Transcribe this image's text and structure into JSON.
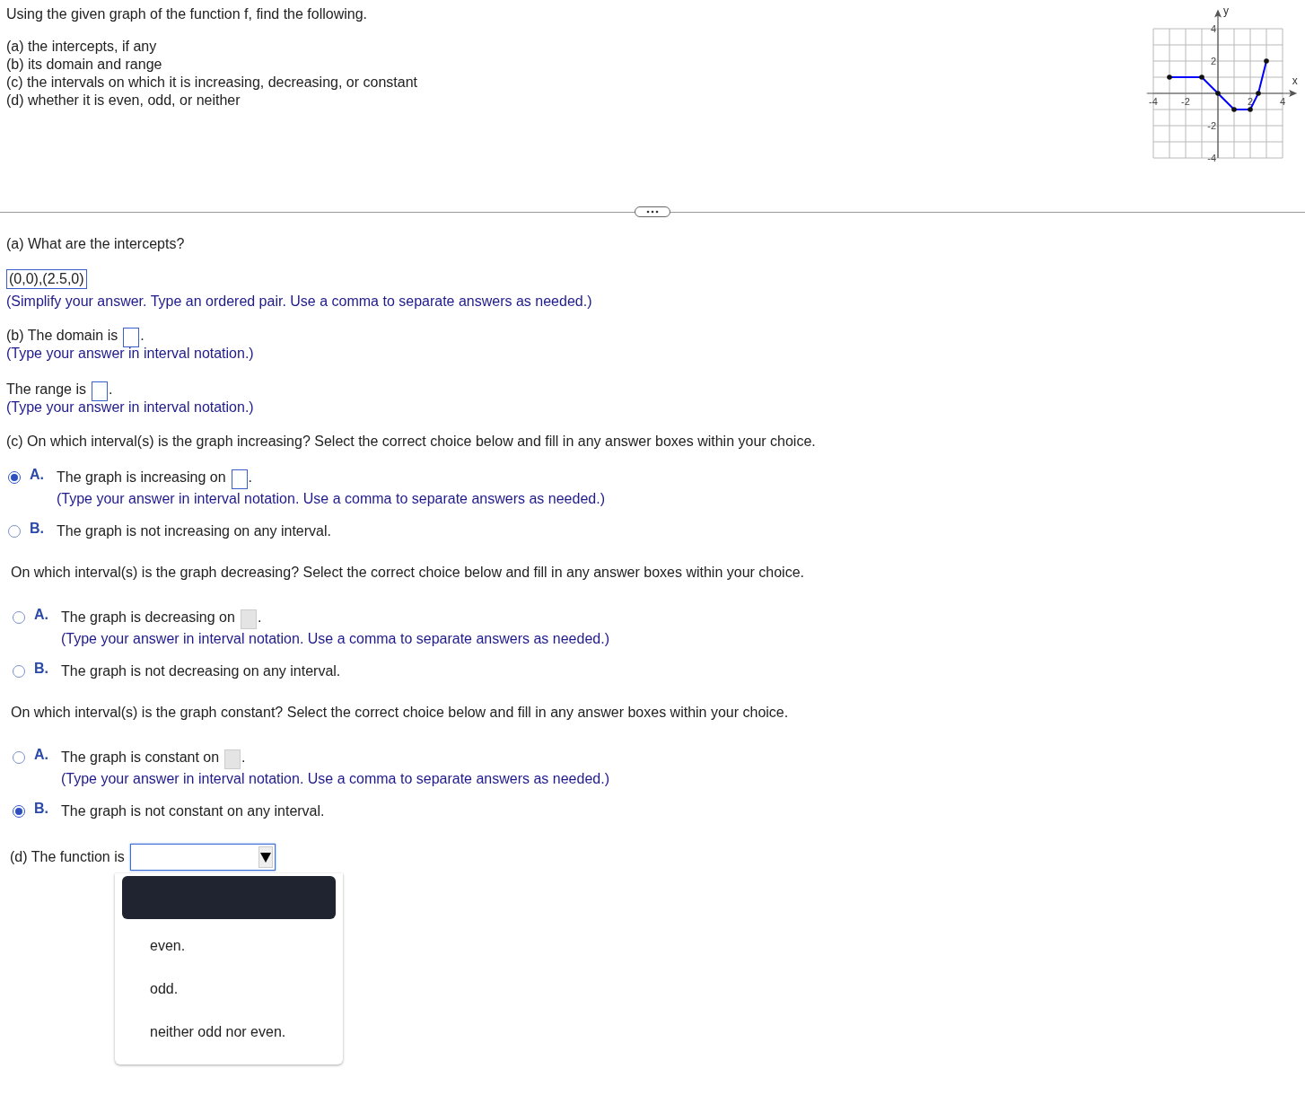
{
  "problem": {
    "intro": "Using the given graph of the function f, find the following.",
    "parts": [
      "(a)  the intercepts, if any",
      "(b)  its domain and range",
      "(c)  the intervals on which it is increasing, decreasing, or constant",
      "(d)  whether it is even, odd, or neither"
    ],
    "chart_data": {
      "type": "line",
      "grid": true,
      "xlabel": "x",
      "ylabel": "y",
      "xlim": [
        -4,
        4
      ],
      "ylim": [
        -4,
        4
      ],
      "xticks": [
        -4,
        -2,
        2,
        4
      ],
      "yticks": [
        -4,
        -2,
        2,
        4
      ],
      "x": [
        -3,
        -1,
        0,
        1,
        2,
        2.5,
        3
      ],
      "series": [
        {
          "color": "#0000ff",
          "values": [
            1,
            1,
            0,
            -1,
            -1,
            0,
            2
          ]
        }
      ]
    }
  },
  "part_a": {
    "question": "(a)  What are the intercepts?",
    "answer": "(0,0),(2.5,0)",
    "hint": "(Simplify your answer. Type an ordered pair. Use a comma to separate answers as needed.)"
  },
  "part_b": [
    {
      "label": "(b)  The domain is",
      "end": ".",
      "hint": "(Type your answer in interval notation.)"
    },
    {
      "label": "The range is",
      "end": ".",
      "hint": "(Type your answer in interval notation.)"
    }
  ],
  "part_c": [
    {
      "question": "(c)  On which interval(s) is the graph increasing?  Select the correct choice below and fill in any answer boxes within your choice.",
      "choices": [
        {
          "letter": "A.",
          "text": "The graph is increasing on",
          "end": ".",
          "field_disabled": false,
          "hint": "(Type your answer in interval notation. Use a comma to separate answers as needed.)",
          "selected": true
        },
        {
          "letter": "B.",
          "text": "The graph is not increasing on any interval.",
          "selected": false
        }
      ]
    },
    {
      "question": "On which interval(s) is the graph decreasing? Select the correct choice below and fill in any answer boxes within your choice.",
      "choices": [
        {
          "letter": "A.",
          "text": "The graph is decreasing on",
          "end": ".",
          "field_disabled": true,
          "hint": "(Type your answer in interval notation. Use a comma to separate answers as needed.)",
          "selected": false
        },
        {
          "letter": "B.",
          "text": "The graph is not decreasing on any interval.",
          "selected": false
        }
      ]
    },
    {
      "question": "On which interval(s) is the graph constant? Select the correct choice below and fill in any answer boxes within your choice.",
      "choices": [
        {
          "letter": "A.",
          "text": "The graph is constant on",
          "end": ".",
          "field_disabled": true,
          "hint": "(Type your answer in interval notation. Use a comma to separate answers as needed.)",
          "selected": false
        },
        {
          "letter": "B.",
          "text": "The graph is not constant on any interval.",
          "selected": true
        }
      ]
    }
  ],
  "part_d": {
    "label": "(d)  The function is",
    "expanded": true,
    "options": [
      {
        "label": "even.",
        "selected": false
      },
      {
        "label": "odd.",
        "selected": false
      },
      {
        "label": "neither odd nor even.",
        "selected": false
      }
    ]
  }
}
